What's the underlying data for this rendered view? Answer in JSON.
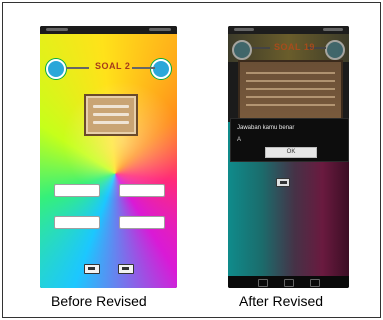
{
  "captions": {
    "before": "Before Revised",
    "after": "After Revised"
  },
  "before_screen": {
    "title": "SOAL 2",
    "buttons": [
      "",
      "",
      "",
      ""
    ]
  },
  "after_screen": {
    "title": "SOAL 19",
    "dialog": {
      "line1": "Jawaban kamu benar",
      "line2": "A",
      "ok_label": "OK"
    }
  },
  "colors": {
    "frame": "#333333",
    "title_text": "#A63B1A"
  }
}
